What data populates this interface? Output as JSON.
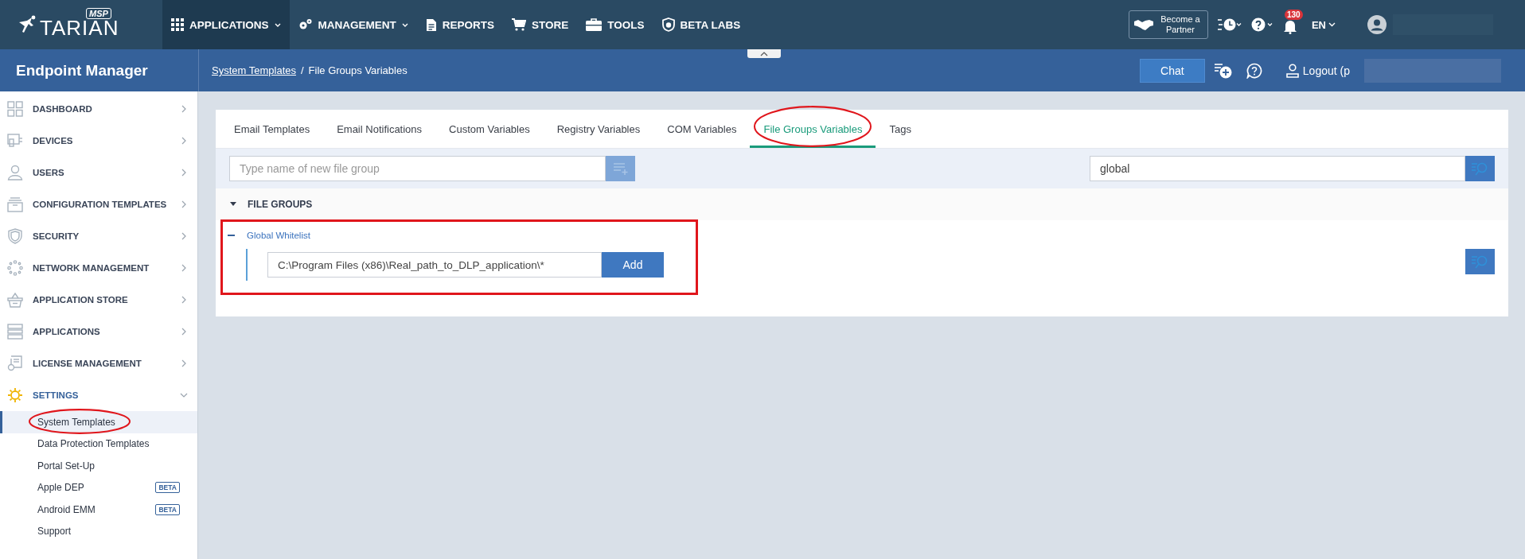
{
  "topbar": {
    "brand": "TARIAN",
    "brand_badge": "MSP",
    "nav": [
      {
        "label": "APPLICATIONS",
        "selected": true,
        "dropdown": true
      },
      {
        "label": "MANAGEMENT",
        "selected": false,
        "dropdown": true
      },
      {
        "label": "REPORTS",
        "selected": false,
        "dropdown": false
      },
      {
        "label": "STORE",
        "selected": false,
        "dropdown": false
      },
      {
        "label": "TOOLS",
        "selected": false,
        "dropdown": false
      },
      {
        "label": "BETA LABS",
        "selected": false,
        "dropdown": false
      }
    ],
    "partner_button": "Become a Partner",
    "notification_count": "130",
    "language": "EN"
  },
  "header": {
    "title": "Endpoint Manager",
    "breadcrumb_separator": "/",
    "breadcrumb": [
      {
        "label": "System Templates",
        "link": true
      },
      {
        "label": "File Groups Variables",
        "link": false
      }
    ],
    "chat_button": "Chat",
    "logout": "Logout (p"
  },
  "sidebar": {
    "items": [
      {
        "label": "DASHBOARD",
        "expanded": false
      },
      {
        "label": "DEVICES",
        "expanded": false
      },
      {
        "label": "USERS",
        "expanded": false
      },
      {
        "label": "CONFIGURATION TEMPLATES",
        "expanded": false
      },
      {
        "label": "SECURITY",
        "expanded": false
      },
      {
        "label": "NETWORK MANAGEMENT",
        "expanded": false
      },
      {
        "label": "APPLICATION STORE",
        "expanded": false
      },
      {
        "label": "APPLICATIONS",
        "expanded": false
      },
      {
        "label": "LICENSE MANAGEMENT",
        "expanded": false
      },
      {
        "label": "SETTINGS",
        "expanded": true,
        "children": [
          {
            "label": "System Templates",
            "selected": true
          },
          {
            "label": "Data Protection Templates",
            "selected": false
          },
          {
            "label": "Portal Set-Up",
            "selected": false
          },
          {
            "label": "Apple DEP",
            "selected": false,
            "badge": "BETA"
          },
          {
            "label": "Android EMM",
            "selected": false,
            "badge": "BETA"
          },
          {
            "label": "Support",
            "selected": false
          }
        ]
      }
    ]
  },
  "tabs": [
    {
      "label": "Email Templates",
      "selected": false
    },
    {
      "label": "Email Notifications",
      "selected": false
    },
    {
      "label": "Custom Variables",
      "selected": false
    },
    {
      "label": "Registry Variables",
      "selected": false
    },
    {
      "label": "COM Variables",
      "selected": false
    },
    {
      "label": "File Groups Variables",
      "selected": true
    },
    {
      "label": "Tags",
      "selected": false
    }
  ],
  "new_group": {
    "placeholder": "Type name of new file group"
  },
  "search": {
    "value": "global"
  },
  "file_groups": {
    "title": "FILE GROUPS",
    "expanded": true,
    "groups": [
      {
        "name": "Global Whitelist",
        "expanded": true,
        "path_value": "C:\\Program Files (x86)\\Real_path_to_DLP_application\\*",
        "add_button": "Add"
      }
    ]
  }
}
